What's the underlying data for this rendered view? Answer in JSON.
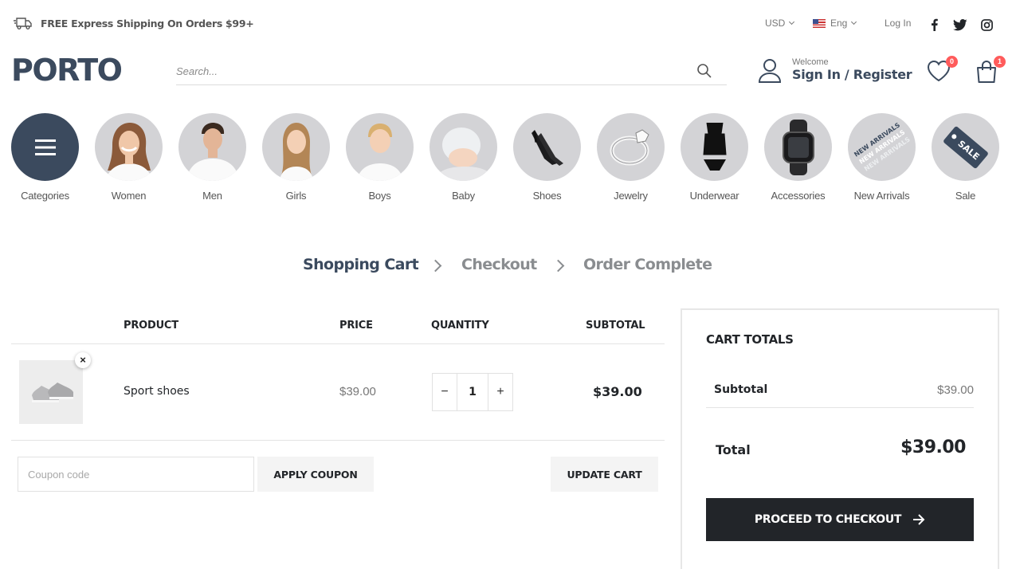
{
  "topbar": {
    "shipping_text": "FREE Express Shipping On Orders $99+",
    "currency": "USD",
    "language": "Eng",
    "login": "Log In",
    "social": [
      "facebook-icon",
      "twitter-icon",
      "instagram-icon"
    ]
  },
  "header": {
    "logo": "PORTO",
    "search_placeholder": "Search...",
    "welcome": "Welcome",
    "signin": "Sign In / Register",
    "wishlist_count": "0",
    "cart_count": "1"
  },
  "categories": [
    {
      "label": "Categories",
      "icon": "menu-icon"
    },
    {
      "label": "Women"
    },
    {
      "label": "Men"
    },
    {
      "label": "Girls"
    },
    {
      "label": "Boys"
    },
    {
      "label": "Baby"
    },
    {
      "label": "Shoes"
    },
    {
      "label": "Jewelry"
    },
    {
      "label": "Underwear"
    },
    {
      "label": "Accessories"
    },
    {
      "label": "New Arrivals"
    },
    {
      "label": "Sale"
    }
  ],
  "new_arrivals_text": "NEW ARRIVALS",
  "sale_tag_text": "SALE",
  "steps": [
    "Shopping Cart",
    "Checkout",
    "Order Complete"
  ],
  "cart": {
    "headers": {
      "product": "PRODUCT",
      "price": "PRICE",
      "quantity": "QUANTITY",
      "subtotal": "SUBTOTAL"
    },
    "items": [
      {
        "name": "Sport shoes",
        "price": "$39.00",
        "quantity": "1",
        "subtotal": "$39.00",
        "remove": "×"
      }
    ],
    "coupon_placeholder": "Coupon code",
    "apply_coupon": "APPLY COUPON",
    "update_cart": "UPDATE CART",
    "qty_minus": "−",
    "qty_plus": "+"
  },
  "totals": {
    "title": "CART TOTALS",
    "subtotal_label": "Subtotal",
    "subtotal_value": "$39.00",
    "total_label": "Total",
    "total_value": "$39.00",
    "checkout": "PROCEED TO CHECKOUT"
  },
  "colors": {
    "brand": "#3b4a5e",
    "badge": "#ff5b5b",
    "dark_button": "#222529"
  }
}
